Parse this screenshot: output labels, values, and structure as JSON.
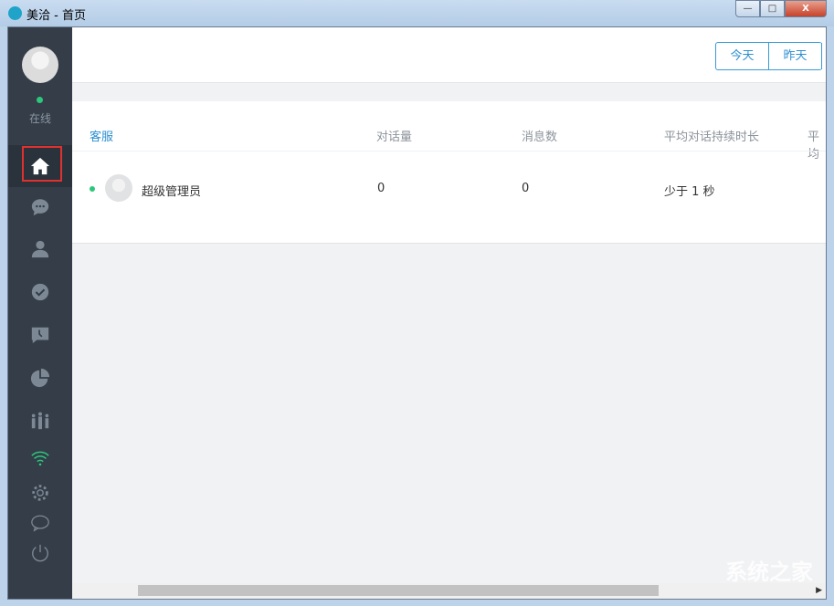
{
  "window": {
    "title": "美洽 - 首页",
    "min": "—",
    "max": "□",
    "close": "X"
  },
  "sidebar": {
    "status": "在线",
    "status_color": "#2dc77c",
    "items": [
      {
        "icon": "home-icon",
        "active": true
      },
      {
        "icon": "chat-bubble-icon"
      },
      {
        "icon": "user-icon"
      },
      {
        "icon": "check-circle-icon"
      },
      {
        "icon": "message-clock-icon"
      },
      {
        "icon": "pie-chart-icon"
      },
      {
        "icon": "team-icon"
      }
    ],
    "bottom": [
      {
        "icon": "wifi-icon"
      },
      {
        "icon": "gear-icon"
      },
      {
        "icon": "feedback-bubble-icon"
      },
      {
        "icon": "power-icon"
      }
    ]
  },
  "header": {
    "date_buttons": [
      "今天",
      "昨天"
    ]
  },
  "table": {
    "columns": [
      "客服",
      "对话量",
      "消息数",
      "平均对话持续时长",
      "平均"
    ],
    "rows": [
      {
        "name": "超级管理员",
        "conversations": "0",
        "messages": "0",
        "avg_duration": "少于 1 秒",
        "online": true
      }
    ]
  },
  "watermark": "系统之家",
  "accent": "#2d8fd1"
}
